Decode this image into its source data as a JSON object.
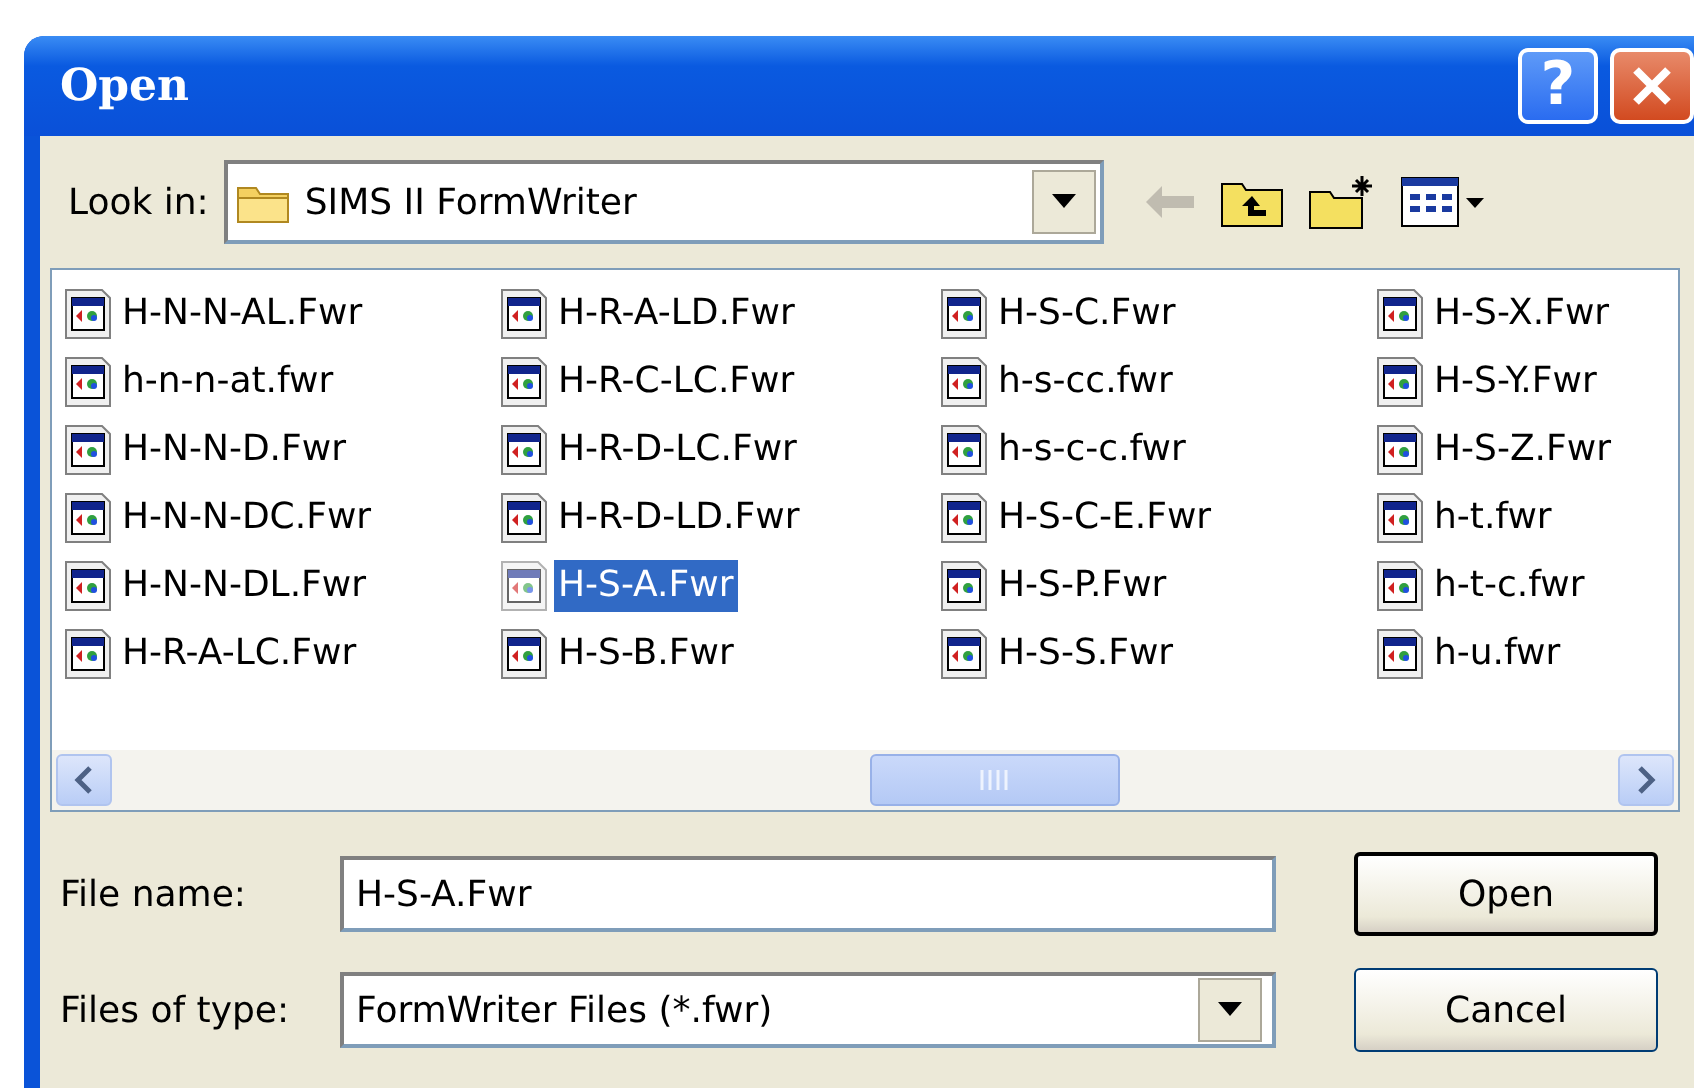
{
  "window": {
    "title": "Open",
    "help_label": "?"
  },
  "look_in": {
    "label": "Look in:",
    "value": "SIMS II FormWriter"
  },
  "files": [
    {
      "name": "H-N-N-AL.Fwr",
      "selected": false
    },
    {
      "name": "h-n-n-at.fwr",
      "selected": false
    },
    {
      "name": "H-N-N-D.Fwr",
      "selected": false
    },
    {
      "name": "H-N-N-DC.Fwr",
      "selected": false
    },
    {
      "name": "H-N-N-DL.Fwr",
      "selected": false
    },
    {
      "name": "H-R-A-LC.Fwr",
      "selected": false
    },
    {
      "name": "H-R-A-LD.Fwr",
      "selected": false
    },
    {
      "name": "H-R-C-LC.Fwr",
      "selected": false
    },
    {
      "name": "H-R-D-LC.Fwr",
      "selected": false
    },
    {
      "name": "H-R-D-LD.Fwr",
      "selected": false
    },
    {
      "name": "H-S-A.Fwr",
      "selected": true
    },
    {
      "name": "H-S-B.Fwr",
      "selected": false
    },
    {
      "name": "H-S-C.Fwr",
      "selected": false
    },
    {
      "name": "h-s-cc.fwr",
      "selected": false
    },
    {
      "name": "h-s-c-c.fwr",
      "selected": false
    },
    {
      "name": "H-S-C-E.Fwr",
      "selected": false
    },
    {
      "name": "H-S-P.Fwr",
      "selected": false
    },
    {
      "name": "H-S-S.Fwr",
      "selected": false
    },
    {
      "name": "H-S-X.Fwr",
      "selected": false
    },
    {
      "name": "H-S-Y.Fwr",
      "selected": false
    },
    {
      "name": "H-S-Z.Fwr",
      "selected": false
    },
    {
      "name": "h-t.fwr",
      "selected": false
    },
    {
      "name": "h-t-c.fwr",
      "selected": false
    },
    {
      "name": "h-u.fwr",
      "selected": false
    }
  ],
  "file_name": {
    "label": "File name:",
    "value": "H-S-A.Fwr"
  },
  "file_type": {
    "label": "Files of type:",
    "value": "FormWriter Files (*.fwr)"
  },
  "buttons": [
    {
      "label": "Open",
      "default": true
    },
    {
      "label": "Cancel",
      "default": false
    }
  ]
}
